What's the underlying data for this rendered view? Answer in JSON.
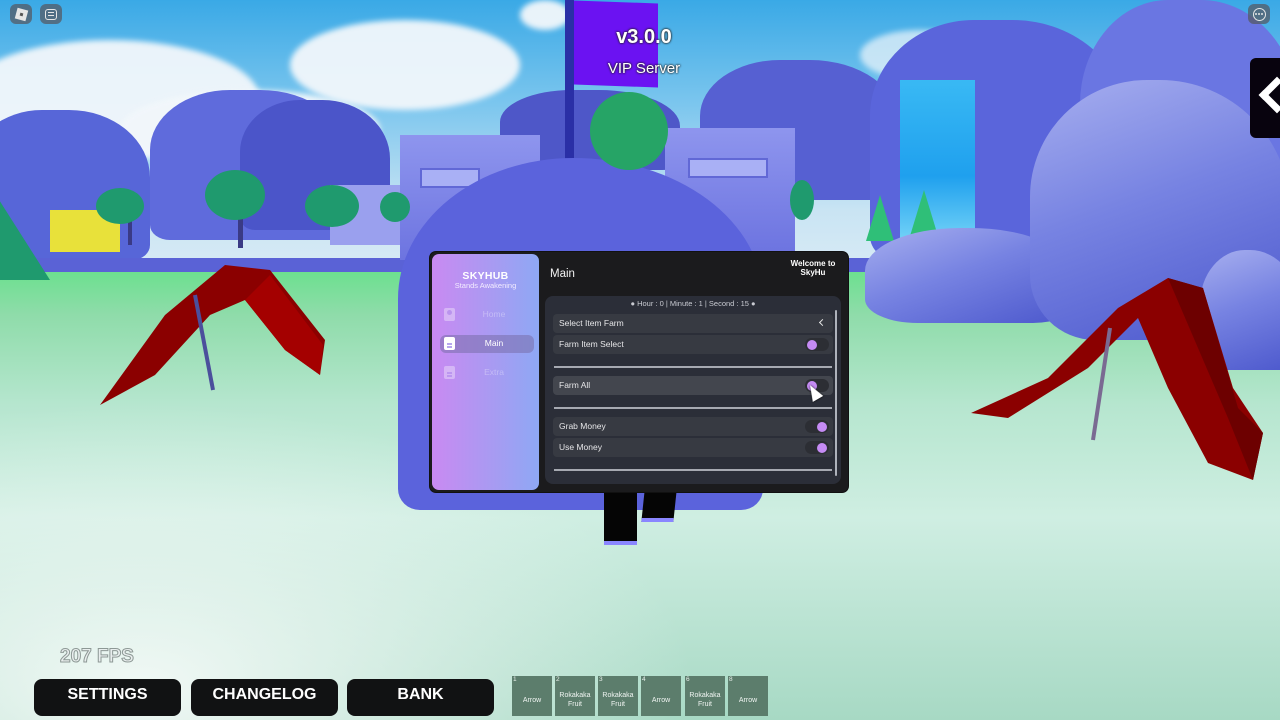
{
  "topbar": {
    "left_icons": [
      "roblox-menu-icon",
      "chat-icon"
    ],
    "right_icons": [
      "more-options-icon"
    ]
  },
  "overlay": {
    "version": "v3.0.0",
    "server_type": "VIP Server"
  },
  "side_tab": {
    "icon": "chevron-left-icon"
  },
  "hub": {
    "brand": "SKYHUB",
    "subtitle": "Stands Awakening",
    "nav": [
      {
        "label": "Home",
        "icon": "user-icon",
        "active": false
      },
      {
        "label": "Main",
        "icon": "document-icon",
        "active": true
      },
      {
        "label": "Extra",
        "icon": "document-icon",
        "active": false
      }
    ],
    "page_title": "Main",
    "welcome": "Welcome to SkyHu",
    "timer": "Hour : 0 | Minute : 1 | Second : 15",
    "rows": [
      {
        "label": "Select Item Farm",
        "type": "dropdown",
        "icon": "chevron-left-icon"
      },
      {
        "label": "Farm Item Select",
        "type": "toggle",
        "state": "off"
      },
      {
        "label": "Farm All",
        "type": "toggle",
        "state": "off"
      },
      {
        "label": "Grab Money",
        "type": "toggle",
        "state": "on"
      },
      {
        "label": "Use Money",
        "type": "toggle",
        "state": "on"
      }
    ],
    "accent_color": "#c58bf4"
  },
  "hud": {
    "fps": "207 FPS",
    "buttons": [
      "SETTINGS",
      "CHANGELOG",
      "BANK"
    ],
    "hotbar": [
      {
        "slot": "1",
        "item": "Arrow"
      },
      {
        "slot": "2",
        "item": "Rokakaka Fruit"
      },
      {
        "slot": "3",
        "item": "Rokakaka Fruit"
      },
      {
        "slot": "4",
        "item": "Arrow"
      },
      {
        "slot": "6",
        "item": "Rokakaka Fruit"
      },
      {
        "slot": "8",
        "item": "Arrow"
      }
    ]
  }
}
